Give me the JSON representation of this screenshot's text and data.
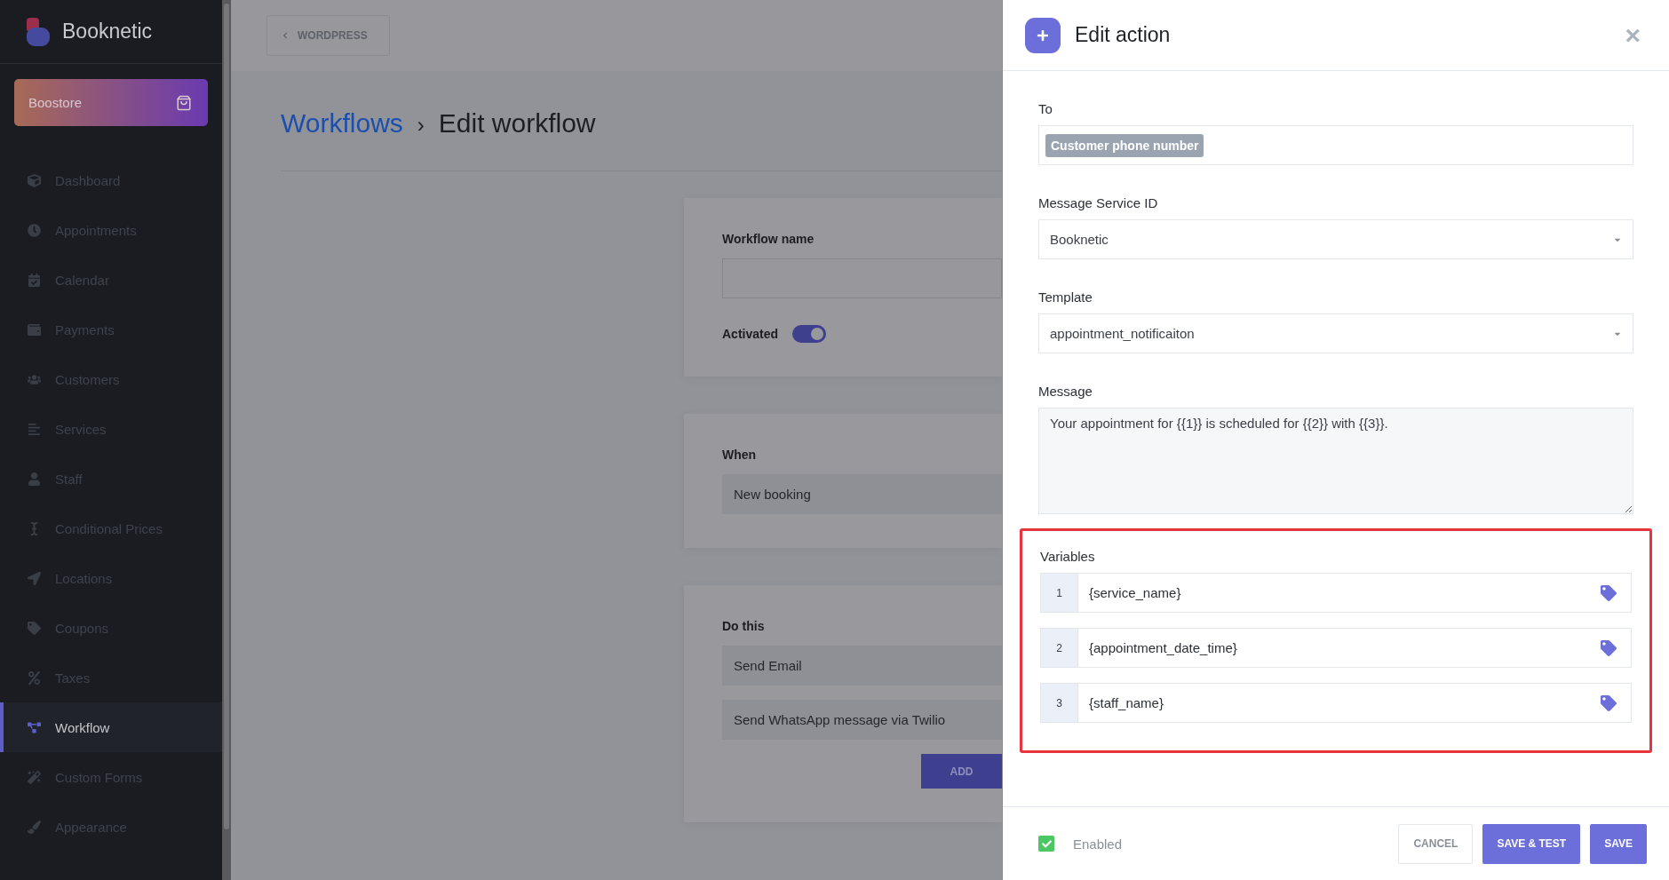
{
  "sidebar": {
    "brand": "Booknetic",
    "boostore": "Boostore",
    "items": [
      {
        "label": "Dashboard",
        "selected": false
      },
      {
        "label": "Appointments",
        "selected": false
      },
      {
        "label": "Calendar",
        "selected": false
      },
      {
        "label": "Payments",
        "selected": false
      },
      {
        "label": "Customers",
        "selected": false
      },
      {
        "label": "Services",
        "selected": false
      },
      {
        "label": "Staff",
        "selected": false
      },
      {
        "label": "Conditional Prices",
        "selected": false
      },
      {
        "label": "Locations",
        "selected": false
      },
      {
        "label": "Coupons",
        "selected": false
      },
      {
        "label": "Taxes",
        "selected": false
      },
      {
        "label": "Workflow",
        "selected": true
      },
      {
        "label": "Custom Forms",
        "selected": false
      },
      {
        "label": "Appearance",
        "selected": false
      }
    ]
  },
  "topbar": {
    "back_button": "WORDPRESS"
  },
  "breadcrumb": {
    "parent": "Workflows",
    "separator": "›",
    "current": "Edit workflow"
  },
  "workflow_card": {
    "name_label": "Workflow name",
    "activated_label": "Activated",
    "activated": true
  },
  "when_card": {
    "label": "When",
    "trigger": "New booking"
  },
  "do_card": {
    "label": "Do this",
    "actions": [
      "Send Email",
      "Send WhatsApp message via Twilio"
    ],
    "add_button": "ADD"
  },
  "panel": {
    "title": "Edit action",
    "close": "×",
    "to": {
      "label": "To",
      "tags": [
        "Customer phone number"
      ]
    },
    "selects": [
      {
        "label": "Message Service ID",
        "value": "Booknetic"
      },
      {
        "label": "Template",
        "value": "appointment_notificaiton"
      }
    ],
    "message": {
      "label": "Message",
      "value": "Your appointment for {{1}} is scheduled for {{2}} with {{3}}."
    },
    "variables": {
      "label": "Variables",
      "highlighted": true,
      "rows": [
        {
          "index": "1",
          "value": "{service_name}"
        },
        {
          "index": "2",
          "value": "{appointment_date_time}"
        },
        {
          "index": "3",
          "value": "{staff_name}"
        }
      ]
    },
    "footer": {
      "enabled_label": "Enabled",
      "enabled": true,
      "buttons": [
        {
          "label": "CANCEL",
          "kind": "secondary"
        },
        {
          "label": "SAVE & TEST",
          "kind": "primary"
        },
        {
          "label": "SAVE",
          "kind": "primary"
        }
      ]
    }
  }
}
